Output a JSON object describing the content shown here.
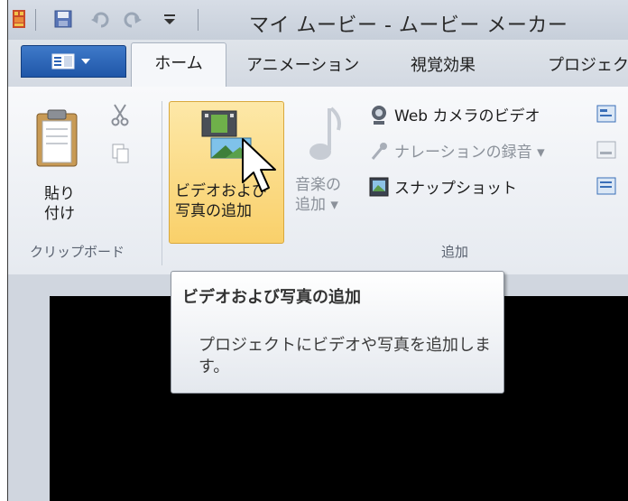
{
  "titlebar": {
    "title": "マイ ムービー - ムービー メーカー",
    "icons": [
      "app-icon",
      "save-icon",
      "undo-icon",
      "redo-icon",
      "customize-dropdown-icon"
    ]
  },
  "tabs": {
    "file_menu_icon": "file-menu-icon",
    "home": "ホーム",
    "animation": "アニメーション",
    "visual_effects": "視覚効果",
    "project": "プロジェク"
  },
  "ribbon": {
    "clipboard": {
      "paste_line1": "貼り",
      "paste_line2": "付け",
      "group_label": "クリップボード"
    },
    "add": {
      "add_videos_line1": "ビデオおよび",
      "add_videos_line2": "写真の追加",
      "add_music_line1": "音楽の",
      "add_music_line2": "追加 ▾",
      "webcam": "Web カメラのビデオ",
      "narration": "ナレーションの録音 ▾",
      "snapshot": "スナップショット",
      "group_label": "追加"
    }
  },
  "tooltip": {
    "title": "ビデオおよび写真の追加",
    "body": "プロジェクトにビデオや写真を追加します。"
  },
  "colors": {
    "highlight": "#f9d06a",
    "file_button": "#1f56a8",
    "video_bg": "#000000"
  }
}
